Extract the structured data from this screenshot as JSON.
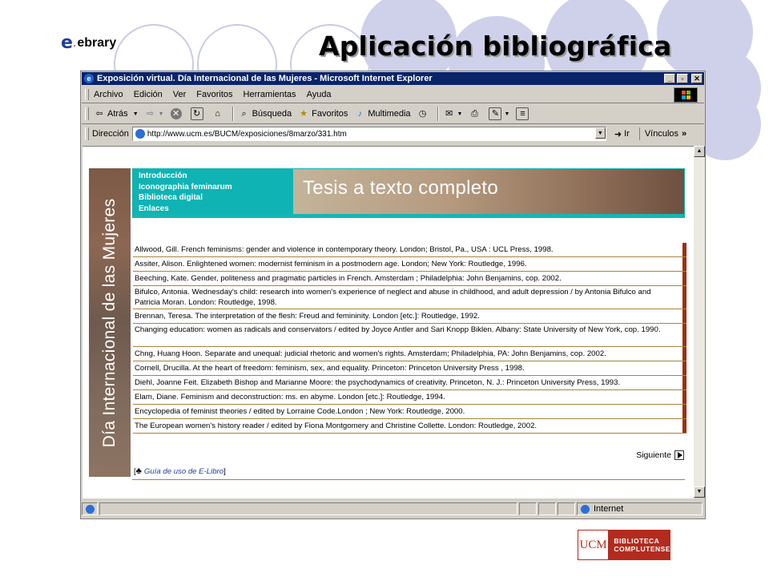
{
  "slide": {
    "title": "Aplicación bibliográfica",
    "logo_mark": "e",
    "logo_text": "ebrary",
    "ucm_logo": {
      "mark": "UCM",
      "line1": "BIBLIOTECA",
      "line2": "COMPLUTENSE"
    }
  },
  "browser": {
    "title": "Exposición virtual. Día Internacional de las Mujeres - Microsoft Internet Explorer",
    "window_buttons": [
      "_",
      "▫",
      "✕"
    ],
    "menu": [
      "Archivo",
      "Edición",
      "Ver",
      "Favoritos",
      "Herramientas",
      "Ayuda"
    ],
    "toolbar": {
      "back": "Atrás",
      "search": "Búsqueda",
      "favorites": "Favoritos",
      "multimedia": "Multimedia"
    },
    "address": {
      "label": "Dirección",
      "url": "http://www.ucm.es/BUCM/exposiciones/8marzo/331.htm",
      "go": "Ir",
      "links": "Vínculos"
    },
    "status": {
      "zone": "Internet"
    }
  },
  "page": {
    "side_title": "Día Internacional de las Mujeres",
    "nav": [
      "Introducción",
      "Iconographia feminarum",
      "Biblioteca digital",
      "Enlaces"
    ],
    "banner_title": "Tesis a texto completo",
    "bibliography": [
      "Allwood, Gill. French feminisms: gender and violence in contemporary theory. London; Bristol, Pa., USA : UCL Press, 1998.",
      "Assiter, Alison. Enlightened women: modernist feminism in a postmodern age. London; New York: Routledge, 1996.",
      "Beeching, Kate. Gender, politeness and pragmatic particles in French. Amsterdam ; Philadelphia: John Benjamins, cop. 2002.",
      "Bifulco, Antonia. Wednesday's child: research into women's experience of neglect and abuse in childhood, and adult depression / by Antonia Bifulco and Patricia Moran. London: Routledge, 1998.",
      "Brennan, Teresa. The interpretation of the flesh: Freud and femininity. London [etc.]: Routledge, 1992.",
      "Changing education: women as radicals and conservators / edited by Joyce Antler and Sari Knopp Biklen. Albany: State University of New York, cop. 1990.",
      "Chng, Huang Hoon. Separate and unequal: judicial rhetoric and women's rights. Amsterdam; Philadelphia, PA: John Benjamins, cop. 2002.",
      "Cornell, Drucilla. At the heart of freedom: feminism, sex, and equality. Princeton: Princeton University Press , 1998.",
      "Diehl, Joanne Feit. Elizabeth Bishop and Marianne Moore: the psychodynamics of creativity. Princeton, N. J.: Princeton University Press, 1993.",
      "Elam, Diane. Feminism and deconstruction: ms. en abyme. London [etc.]: Routledge, 1994.",
      "Encyclopedia of feminist theories / edited by Lorraine Code.London ; New York: Routledge, 2000.",
      "The European women's history reader / edited by Fiona Montgomery and Christine Collette. London: Routledge, 2002."
    ],
    "next": "Siguiente",
    "guide_bracket_open": "[",
    "guide_link": "Guía de uso de E-Libro",
    "guide_bracket_close": "]"
  }
}
